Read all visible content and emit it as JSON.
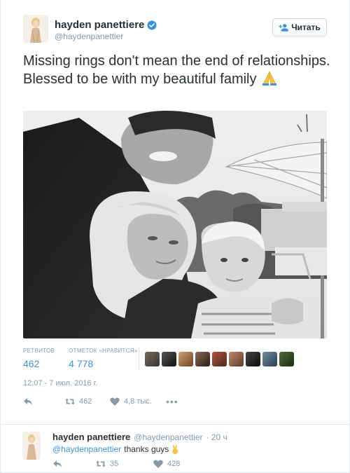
{
  "tweet": {
    "author": {
      "name": "hayden panettiere",
      "handle": "@haydenpanettier"
    },
    "follow_label": "Читать",
    "text": "Missing rings don't mean the end of relationships. Blessed to be with my beautiful family",
    "emoji_icon": "folded-hands-icon",
    "stats": {
      "retweets_label": "РЕТВИТОВ",
      "retweets_value": "462",
      "likes_label": "ОТМЕТОК «НРАВИТСЯ»",
      "likes_value": "4 778"
    },
    "liker_count": 9,
    "timestamp": "12:07 - 7 июл. 2016 г.",
    "actions": {
      "retweet_count": "462",
      "like_count": "4,8 тыс.",
      "more": "•••"
    }
  },
  "reply": {
    "name": "hayden panettiere",
    "handle": "@haydenpanettier",
    "time": "· 20 ч",
    "mention": "@haydenpanettier",
    "text": "thanks guys",
    "retweet_count": "35",
    "like_count": "428"
  },
  "colors": {
    "accent": "#3b94d9",
    "muted": "#8899a6",
    "text": "#292f33",
    "border": "#e1e8ed"
  }
}
